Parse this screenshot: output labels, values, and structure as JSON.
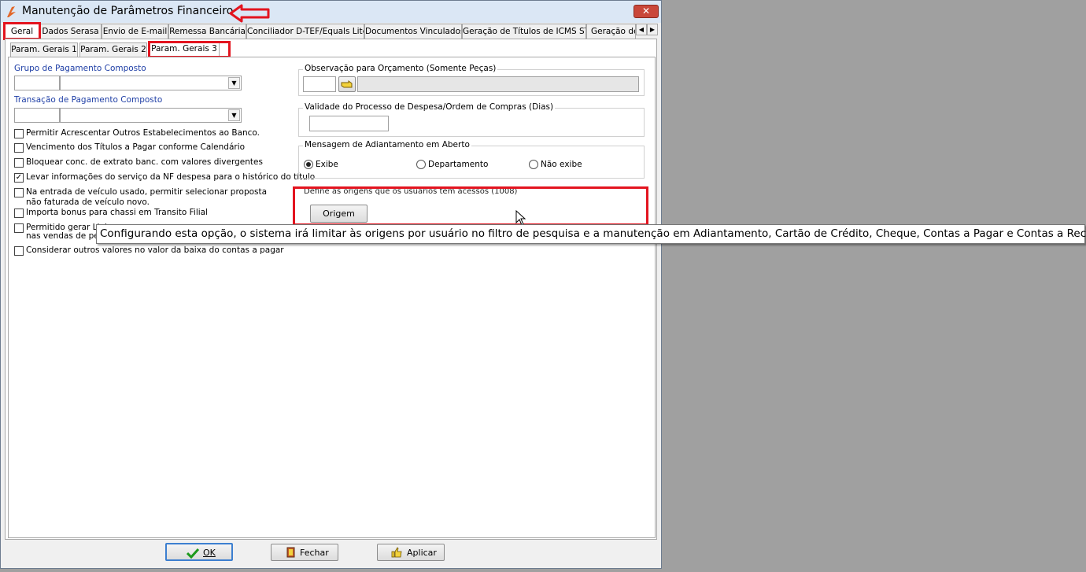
{
  "window": {
    "title": "Manutenção de Parâmetros Financeiro",
    "close_label": "✕"
  },
  "top_tabs": [
    "Geral",
    "Dados Serasa",
    "Envio de E-mail",
    "Remessa Bancária",
    "Conciliador D-TEF/Equals Lite",
    "Documentos Vinculados",
    "Geração de Títulos de ICMS ST",
    "Geração de"
  ],
  "sub_tabs": [
    "Param. Gerais 1",
    "Param. Gerais 2",
    "Param. Gerais 3"
  ],
  "left": {
    "grupo_label": "Grupo de Pagamento Composto",
    "transacao_label": "Transação de Pagamento Composto",
    "checkboxes": [
      {
        "text": "Permitir Acrescentar Outros Estabelecimentos ao Banco.",
        "checked": false
      },
      {
        "text": "Vencimento dos Títulos a Pagar conforme Calendário",
        "checked": false
      },
      {
        "text": "Bloquear conc. de extrato banc. com valores divergentes",
        "checked": false
      },
      {
        "text": "Levar informações do serviço da NF despesa para o histórico do título",
        "checked": true
      },
      {
        "text": "Na entrada de veículo usado, permitir selecionar proposta",
        "text2": "não faturada de veículo novo.",
        "checked": false
      },
      {
        "text": "Importa bonus para chassi em Transito Filial",
        "checked": false
      },
      {
        "text": "Permitido gerar Link",
        "text2": "nas vendas de peç",
        "checked": false
      },
      {
        "text": "Considerar outros valores no valor da baixa do contas a pagar",
        "checked": false
      }
    ]
  },
  "right": {
    "obs_title": "Observação para Orçamento (Somente Peças)",
    "validade_title": "Validade do Processo de Despesa/Ordem de Compras (Dias)",
    "mensagem_title": "Mensagem de Adiantamento em Aberto",
    "radio_options": [
      "Exibe",
      "Departamento",
      "Não exibe"
    ],
    "radio_selected": "Exibe",
    "origens_title": "Define as origens que os usuários tem acessos (1008)",
    "origem_button": "Origem"
  },
  "tooltip": "Configurando esta opção, o sistema irá limitar às origens por usuário no filtro de pesquisa e a manutenção em Adiantamento, Cartão de Crédito, Cheque, Contas a Pagar e Contas a Receber.",
  "buttons": {
    "ok": "OK",
    "fechar": "Fechar",
    "aplicar": "Aplicar"
  },
  "colors": {
    "highlight": "#e3141f",
    "label_blue": "#1f3fa6",
    "ok_check": "#1c9a1c"
  }
}
